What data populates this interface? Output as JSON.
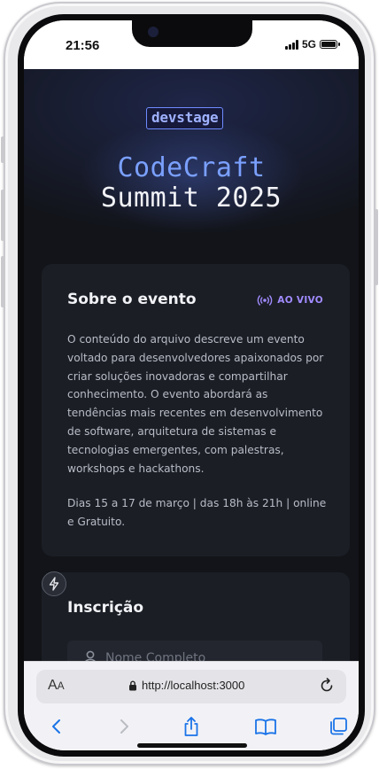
{
  "status": {
    "time": "21:56",
    "network": "5G"
  },
  "brand": {
    "logo": "devstage"
  },
  "hero": {
    "title_line1": "CodeCraft",
    "title_line2": "Summit 2025"
  },
  "about": {
    "title": "Sobre o evento",
    "live_badge": "AO VIVO",
    "description": "O conteúdo do arquivo descreve um evento voltado para desenvolvedores apaixonados por criar soluções inovadoras e compartilhar conhecimento. O evento abordará as tendências mais recentes em desenvolvimento de software, arquitetura de sistemas e tecnologias emergentes, com palestras, workshops e hackathons.",
    "details": "Dias 15 a 17 de março | das 18h às 21h | online e Gratuito."
  },
  "signup": {
    "title": "Inscrição",
    "name_placeholder": "Nome Completo"
  },
  "browser": {
    "text_size_label_big": "A",
    "text_size_label_small": "A",
    "url": "http://localhost:3000"
  },
  "colors": {
    "accent_blue": "#7aa0ff",
    "accent_purple": "#a18bff",
    "page_bg": "#121419",
    "card_bg": "#1b1e25",
    "safari_blue": "#1a73e8"
  },
  "icons": [
    "lightning-icon",
    "broadcast-icon",
    "user-icon",
    "lock-icon",
    "reload-icon",
    "back-icon",
    "forward-icon",
    "share-icon",
    "bookmarks-icon",
    "tabs-icon"
  ]
}
